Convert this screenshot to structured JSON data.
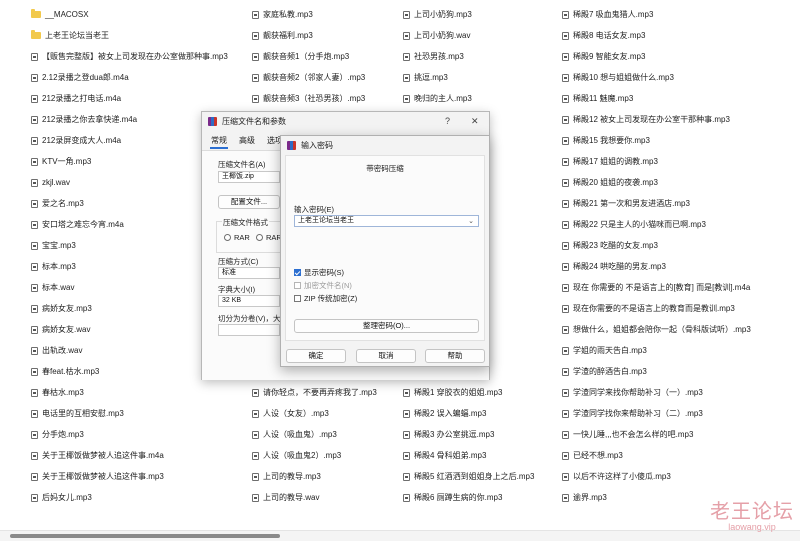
{
  "files": {
    "col1": [
      {
        "type": "folder",
        "name": "__MACOSX"
      },
      {
        "type": "folder",
        "name": "上老王论坛当老王"
      },
      {
        "type": "file",
        "name": "【贩售完整版】被女上司发现在办公室做那种事.mp3"
      },
      {
        "type": "file",
        "name": "2.12录播之登dua郎.m4a"
      },
      {
        "type": "file",
        "name": "212录播之打电话.m4a"
      },
      {
        "type": "file",
        "name": "212录播之你去拿快递.m4a"
      },
      {
        "type": "file",
        "name": "212录屏变成大人.m4a"
      },
      {
        "type": "file",
        "name": "KTV一角.mp3"
      },
      {
        "type": "file",
        "name": "zkjl.wav"
      },
      {
        "type": "file",
        "name": "爱之名.mp3"
      },
      {
        "type": "file",
        "name": "安口塔之难忘今宵.m4a"
      },
      {
        "type": "file",
        "name": "宝宝.mp3"
      },
      {
        "type": "file",
        "name": "标本.mp3"
      },
      {
        "type": "file",
        "name": "标本.wav"
      },
      {
        "type": "file",
        "name": "病娇女友.mp3"
      },
      {
        "type": "file",
        "name": "病娇女友.wav"
      },
      {
        "type": "file",
        "name": "出轨改.wav"
      },
      {
        "type": "file",
        "name": "春feat.枯水.mp3"
      },
      {
        "type": "file",
        "name": "春枯水.mp3"
      },
      {
        "type": "file",
        "name": "电话里的互相安慰.mp3"
      },
      {
        "type": "file",
        "name": "分手炮.mp3"
      },
      {
        "type": "file",
        "name": "关于王椰饭做梦被人追这件事.m4a"
      },
      {
        "type": "file",
        "name": "关于王椰饭做梦被人追这件事.mp3"
      },
      {
        "type": "file",
        "name": "后妈女儿.mp3"
      }
    ],
    "col2": [
      "家庭私教.mp3",
      "靓获福利.mp3",
      "靓获音频1（分手炮.mp3",
      "靓获音频2（邻家人妻）.mp3",
      "靓获音频3（社恐男孩）.mp3",
      "",
      "",
      "",
      "",
      "",
      "",
      "",
      "",
      "",
      "",
      "",
      "",
      "",
      "请你轻点，不要再弄疼我了.mp3",
      "人设（女友）.mp3",
      "人设（吸血鬼）.mp3",
      "人设（吸血鬼2）.mp3",
      "上司的教导.mp3",
      "上司的教导.wav"
    ],
    "col3": [
      "上司小奶狗.mp3",
      "上司小奶狗.wav",
      "社恐男孩.mp3",
      "挑逗.mp3",
      "晚归的主人.mp3",
      "",
      "",
      "",
      "",
      "",
      "",
      "",
      "",
      "",
      "",
      "",
      "",
      "",
      "稀殿1 穿胶衣的姐姐.mp3",
      "稀殿2 误入蝙蝠.mp3",
      "稀殿3 办公室挑逗.mp3",
      "稀殿4 骨科姐弟.mp3",
      "稀殿5 红酒洒到姐姐身上之后.mp3",
      "稀殿6 厕蹲生病的你.mp3"
    ],
    "col4": [
      "稀殿7 吸血鬼猎人.mp3",
      "稀殿8 电话女友.mp3",
      "稀殿9 智能女友.mp3",
      "稀殿10 想与姐姐做什么.mp3",
      "稀殿11 魅魔.mp3",
      "稀殿12 被女上司发现在办公室干那种事.mp3",
      "稀殿15 我想要你.mp3",
      "稀殿17 姐姐的调教.mp3",
      "稀殿20 姐姐的夜袭.mp3",
      "稀殿21 第一次和男友进酒店.mp3",
      "稀殿22 只是主人的小猫咪而已啊.mp3",
      "稀殿23 吃醋的女友.mp3",
      "稀殿24 哄吃醋的男友.mp3",
      "现在 你需要的  不是语言上的[教育]   而是[教训].m4a",
      "现在你需要的不是语言上的教育而是教训.mp3",
      "想做什么，姐姐都会陪你一起（骨科版试听）.mp3",
      "学姐的雨天告白.mp3",
      "学渣的醉酒告白.mp3",
      "学渣同学来找你帮助补习（一）.mp3",
      "学渣同学找你来帮助补习（二）.mp3",
      "一快儿睡,,,也不会怎么样的吧.mp3",
      "已经不想.mp3",
      "以后不许这样了小傻瓜.mp3",
      "逾界.mp3"
    ]
  },
  "dialog_params": {
    "title": "压缩文件名和参数",
    "help_glyph": "?",
    "close_glyph": "✕",
    "tabs": [
      "常规",
      "高级",
      "选项"
    ],
    "archive_name_label": "压缩文件名(A)",
    "archive_name_value": "王椰饭.zip",
    "profiles_button": "配置文件...",
    "format_group_label": "压缩文件格式",
    "format_rar": "RAR",
    "format_rar4": "RAR",
    "method_label": "压缩方式(C)",
    "method_value": "标准",
    "dict_label": "字典大小(I)",
    "dict_value": "32 KB",
    "split_label": "切分为分卷(V)，大小"
  },
  "dialog_password": {
    "title": "输入密码",
    "subtitle": "带密码压缩",
    "password_label": "输入密码(E)",
    "password_value": "上老王论坛当老王",
    "show_password": "显示密码(S)",
    "encrypt_names": "加密文件名(N)",
    "zip_legacy": "ZIP 传统加密(Z)",
    "organize_button": "整理密码(O)...",
    "ok_button": "确定",
    "cancel_button": "取消",
    "help_button": "帮助"
  },
  "watermark": {
    "logo": "老王论坛",
    "url": "laowang.vip"
  }
}
